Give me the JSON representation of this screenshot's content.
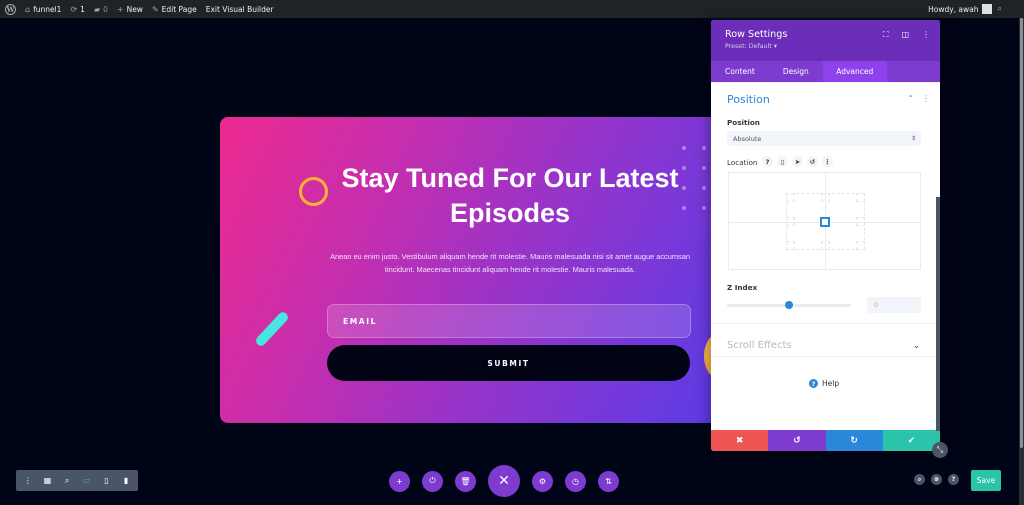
{
  "adminbar": {
    "wp_logo": "W",
    "site_name": "funnel1",
    "updates_count": "1",
    "comments_count": "0",
    "new_label": "New",
    "edit_page_label": "Edit Page",
    "exit_builder_label": "Exit Visual Builder",
    "greeting": "Howdy, awah"
  },
  "hero": {
    "title": "Stay Tuned For Our Latest Episodes",
    "body": "Anean eu enim justo. Vestibulum aliquam hende rit molestie. Mauris malesuada nisi sit amet augue accumsan tincidunt. Maecenas tincidunt aliquam hende rit molestie. Mauris malesuada.",
    "email_placeholder": "EMAIL",
    "submit_label": "SUBMIT"
  },
  "panel": {
    "title": "Row Settings",
    "preset": "Preset: Default ▾",
    "tabs": [
      {
        "label": "Content"
      },
      {
        "label": "Design"
      },
      {
        "label": "Advanced"
      }
    ],
    "active_tab": "Advanced",
    "section_title": "Position",
    "position_label": "Position",
    "position_value": "Absolute",
    "location_label": "Location",
    "zindex_label": "Z Index",
    "zindex_value": "0",
    "zindex_slider_fraction": 0.5,
    "scroll_effects_label": "Scroll Effects",
    "help_label": "Help",
    "footer": {
      "cancel_color": "#ef5555",
      "undo_color": "#7e3bd0",
      "redo_color": "#2b87da",
      "save_color": "#29c4a9"
    }
  },
  "toolbar": {
    "save_label": "Save"
  },
  "colors": {
    "accent_purple": "#7e3bd0",
    "accent_blue": "#2b87da",
    "accent_teal": "#29c4a9",
    "canvas_bg": "#000417"
  }
}
